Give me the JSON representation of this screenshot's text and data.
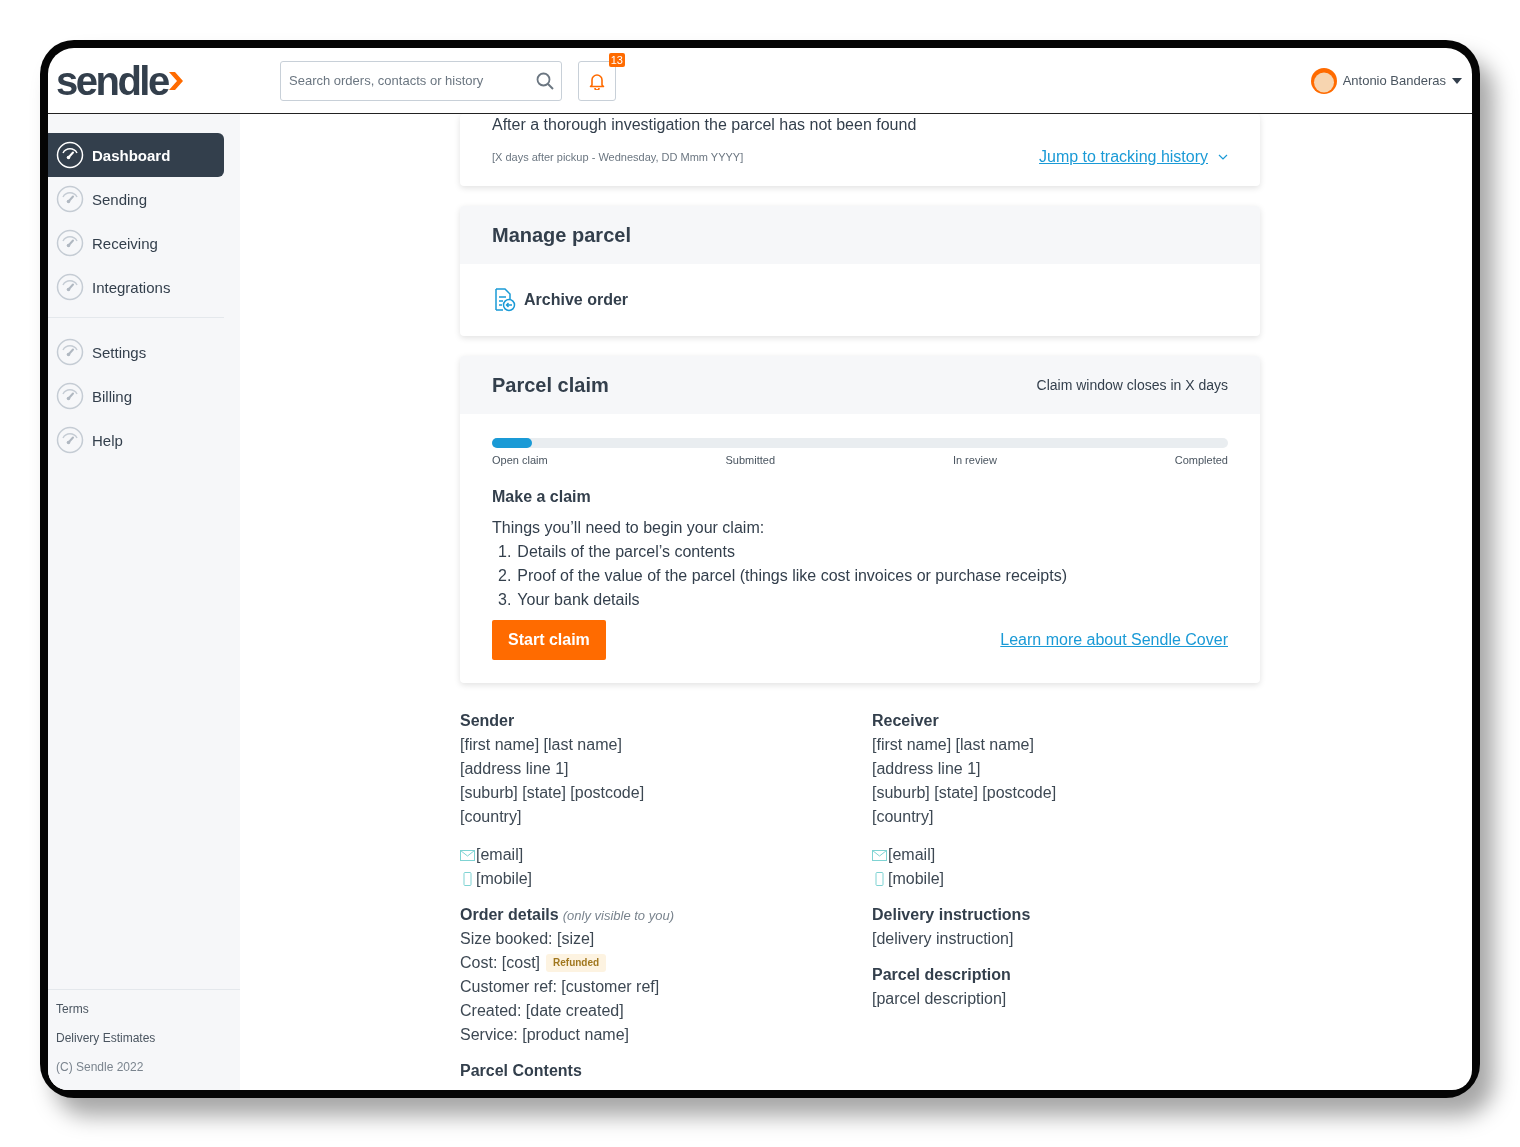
{
  "header": {
    "logo": "sendle",
    "search": {
      "placeholder": "Search orders, contacts or history"
    },
    "notifications": {
      "count": "13"
    },
    "user": {
      "name": "Antonio Banderas"
    }
  },
  "sidebar": {
    "groups": [
      [
        {
          "label": "Dashboard",
          "selected": true
        },
        {
          "label": "Sending",
          "selected": false
        },
        {
          "label": "Receiving",
          "selected": false
        },
        {
          "label": "Integrations",
          "selected": false
        }
      ],
      [
        {
          "label": "Settings",
          "selected": false
        },
        {
          "label": "Billing",
          "selected": false
        },
        {
          "label": "Help",
          "selected": false
        }
      ]
    ],
    "footer": [
      {
        "label": "Terms",
        "kind": "link"
      },
      {
        "label": "Delivery Estimates",
        "kind": "link"
      },
      {
        "label": "(C) Sendle 2022",
        "kind": "note"
      }
    ]
  },
  "tracking_card": {
    "status": "After a thorough investigation the parcel has not been found",
    "date": "[X days after pickup - Wednesday, DD Mmm YYYY]",
    "link": "Jump to tracking history"
  },
  "manage_parcel": {
    "title": "Manage parcel",
    "actions": [
      "Archive order"
    ]
  },
  "parcel_claim": {
    "title": "Parcel claim",
    "window_note": "Claim window closes in X days",
    "progress": {
      "level": 0.055,
      "steps": [
        "Open claim",
        "Submitted",
        "In review",
        "Completed"
      ]
    },
    "heading": "Make a claim",
    "intro": "Things you’ll need to begin your claim:",
    "requirements": [
      {
        "number": "1.",
        "text": "Details of the parcel’s contents"
      },
      {
        "number": "2.",
        "text": "Proof of the value of the parcel (things like cost invoices or purchase receipts)"
      },
      {
        "number": "3.",
        "text": "Your bank details"
      }
    ],
    "button": "Start claim",
    "link": "Learn more about Sendle Cover"
  },
  "details": {
    "columns": [
      [
        {
          "title": "Sender",
          "lines": [
            {
              "text": "[first name] [last name]"
            },
            {
              "text": "[address line 1]"
            },
            {
              "text": "[suburb] [state] [postcode]"
            },
            {
              "text": "[country]"
            }
          ],
          "email": "[email]",
          "mobile": "[mobile]"
        },
        {
          "title": "Order details",
          "note": "(only visible to you)",
          "lines": [
            {
              "text": "Size booked: [size]"
            },
            {
              "text": "Cost: [cost]",
              "badge": "Refunded"
            },
            {
              "text": "Customer ref: [customer ref]"
            },
            {
              "text": "Created: [date created]"
            },
            {
              "text": "Service: [product name]"
            }
          ]
        },
        {
          "title": "Parcel Contents"
        }
      ],
      [
        {
          "title": "Receiver",
          "lines": [
            {
              "text": "[first name] [last name]"
            },
            {
              "text": "[address line 1]"
            },
            {
              "text": "[suburb] [state] [postcode]"
            },
            {
              "text": "[country]"
            }
          ],
          "email": "[email]",
          "mobile": "[mobile]"
        },
        {
          "title": "Delivery instructions",
          "lines": [
            {
              "text": "[delivery instruction]"
            }
          ]
        },
        {
          "title": "Parcel description",
          "lines": [
            {
              "text": "[parcel description]"
            }
          ]
        }
      ]
    ]
  }
}
